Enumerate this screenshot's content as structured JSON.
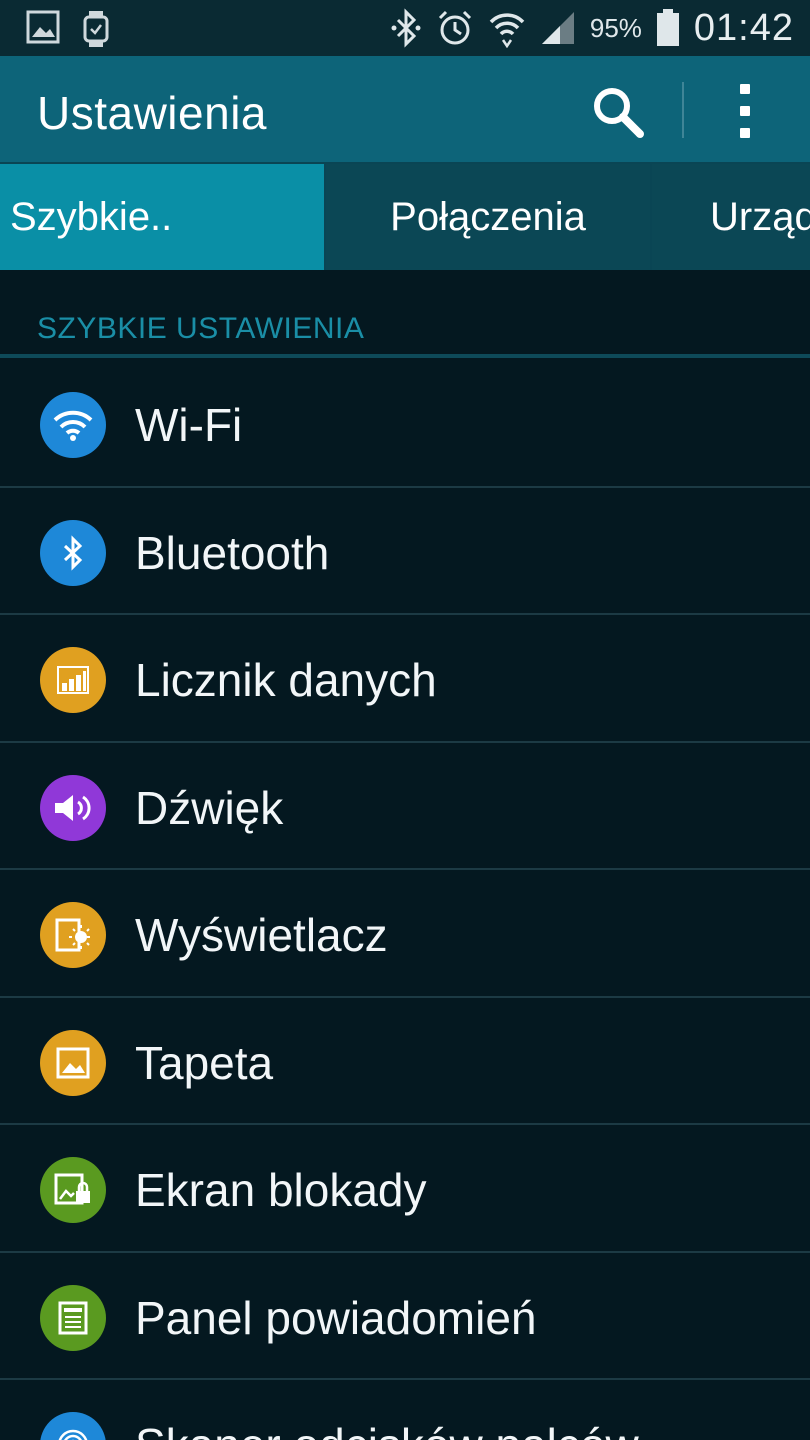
{
  "status_bar": {
    "battery_percent": "95%",
    "time": "01:42",
    "icons": [
      "gallery-icon",
      "watch-icon",
      "bluetooth-icon",
      "alarm-icon",
      "wifi-icon",
      "signal-icon",
      "battery-icon"
    ]
  },
  "action_bar": {
    "title": "Ustawienia",
    "search_icon": "search-icon",
    "menu_icon": "overflow-menu-icon"
  },
  "tabs": [
    {
      "label": "Szybkie..",
      "active": true
    },
    {
      "label": "Połączenia",
      "active": false
    },
    {
      "label": "Urządzenie",
      "active": false
    }
  ],
  "section": {
    "title": "SZYBKIE USTAWIENIA"
  },
  "items": [
    {
      "label": "Wi-Fi",
      "icon": "wifi-icon",
      "color": "#1e88d8"
    },
    {
      "label": "Bluetooth",
      "icon": "bluetooth-icon",
      "color": "#1e88d8"
    },
    {
      "label": "Licznik danych",
      "icon": "data-usage-icon",
      "color": "#e0a020"
    },
    {
      "label": "Dźwięk",
      "icon": "sound-icon",
      "color": "#9038d8"
    },
    {
      "label": "Wyświetlacz",
      "icon": "display-icon",
      "color": "#e0a020"
    },
    {
      "label": "Tapeta",
      "icon": "wallpaper-icon",
      "color": "#e0a020"
    },
    {
      "label": "Ekran blokady",
      "icon": "lock-screen-icon",
      "color": "#5a9a20"
    },
    {
      "label": "Panel powiadomień",
      "icon": "notification-panel-icon",
      "color": "#5a9a20"
    },
    {
      "label": "Skaner odcisków palców",
      "icon": "fingerprint-icon",
      "color": "#1e88d8"
    }
  ]
}
